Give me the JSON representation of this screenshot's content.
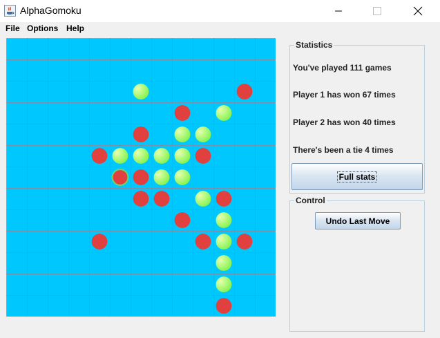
{
  "window": {
    "title": "AlphaGomoku",
    "app_icon": "java-icon"
  },
  "menu": [
    "File",
    "Options",
    "Help"
  ],
  "board": {
    "cols": 13,
    "rows": 13,
    "background": "#00c8ff",
    "grid_color": "#7a8fa8",
    "colors": {
      "red": "#e0413f",
      "green": "#7ef24a",
      "green_highlight": "#e6ffb0"
    },
    "stones": [
      {
        "col": 6,
        "row": 2,
        "color": "green"
      },
      {
        "col": 11,
        "row": 2,
        "color": "red"
      },
      {
        "col": 8,
        "row": 3,
        "color": "red"
      },
      {
        "col": 10,
        "row": 3,
        "color": "green"
      },
      {
        "col": 6,
        "row": 4,
        "color": "red"
      },
      {
        "col": 8,
        "row": 4,
        "color": "green"
      },
      {
        "col": 9,
        "row": 4,
        "color": "green"
      },
      {
        "col": 4,
        "row": 5,
        "color": "red"
      },
      {
        "col": 5,
        "row": 5,
        "color": "green"
      },
      {
        "col": 6,
        "row": 5,
        "color": "green"
      },
      {
        "col": 7,
        "row": 5,
        "color": "green"
      },
      {
        "col": 8,
        "row": 5,
        "color": "green"
      },
      {
        "col": 9,
        "row": 5,
        "color": "red"
      },
      {
        "col": 5,
        "row": 6,
        "color": "red",
        "last_move": true
      },
      {
        "col": 6,
        "row": 6,
        "color": "red"
      },
      {
        "col": 7,
        "row": 6,
        "color": "green"
      },
      {
        "col": 8,
        "row": 6,
        "color": "green"
      },
      {
        "col": 6,
        "row": 7,
        "color": "red"
      },
      {
        "col": 7,
        "row": 7,
        "color": "red"
      },
      {
        "col": 9,
        "row": 7,
        "color": "green"
      },
      {
        "col": 10,
        "row": 7,
        "color": "red"
      },
      {
        "col": 8,
        "row": 8,
        "color": "red"
      },
      {
        "col": 10,
        "row": 8,
        "color": "green"
      },
      {
        "col": 4,
        "row": 9,
        "color": "red"
      },
      {
        "col": 9,
        "row": 9,
        "color": "red"
      },
      {
        "col": 10,
        "row": 9,
        "color": "green"
      },
      {
        "col": 11,
        "row": 9,
        "color": "red"
      },
      {
        "col": 10,
        "row": 10,
        "color": "green"
      },
      {
        "col": 10,
        "row": 11,
        "color": "green"
      },
      {
        "col": 10,
        "row": 12,
        "color": "red"
      }
    ]
  },
  "statistics": {
    "title": "Statistics",
    "games_played": "You've played 111 games",
    "player1": "Player 1 has won 67 times",
    "player2": "Player 2 has won 40 times",
    "ties": "There's been a tie 4 times",
    "full_stats_button": "Full stats"
  },
  "control": {
    "title": "Control",
    "undo_button": "Undo Last Move"
  }
}
